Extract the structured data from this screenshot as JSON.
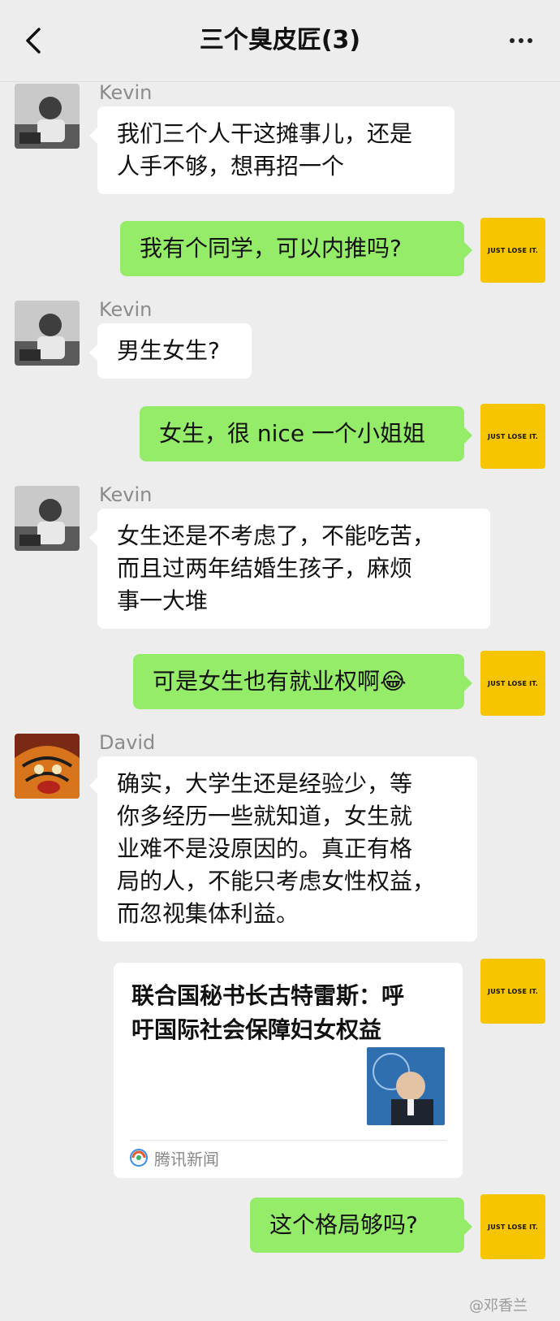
{
  "header": {
    "title": "三个臭皮匠(3)"
  },
  "messages": {
    "m1": {
      "sender": "Kevin",
      "lines": [
        "我们三个人干这摊事儿，还是",
        "人手不够，想再招一个"
      ]
    },
    "m2": {
      "text": "我有个同学，可以内推吗?"
    },
    "m3": {
      "sender": "Kevin",
      "text": "男生女生?"
    },
    "m4": {
      "text": "女生，很 nice 一个小姐姐"
    },
    "m5": {
      "sender": "Kevin",
      "lines": [
        "女生还是不考虑了，不能吃苦，",
        "而且过两年结婚生孩子，麻烦",
        "事一大堆"
      ]
    },
    "m6": {
      "text": "可是女生也有就业权啊",
      "emoji": "😂"
    },
    "m7": {
      "sender": "David",
      "lines": [
        "确实，大学生还是经验少，等",
        "你多经历一些就知道，女生就",
        "业难不是没原因的。真正有格",
        "局的人，不能只考虑女性权益，",
        "而忽视集体利益。"
      ]
    },
    "m8": {
      "card_title_lines": [
        "联合国秘书长古特雷斯：呼",
        "吁国际社会保障妇女权益"
      ],
      "source": "腾讯新闻"
    },
    "m9": {
      "text": "这个格局够吗?"
    }
  },
  "self_avatar_text": "JUST LOSE IT.",
  "watermark": "@邓香兰",
  "colors": {
    "background": "#ededed",
    "outgoing": "#95ec69",
    "incoming": "#ffffff",
    "self_avatar": "#f7c400"
  }
}
